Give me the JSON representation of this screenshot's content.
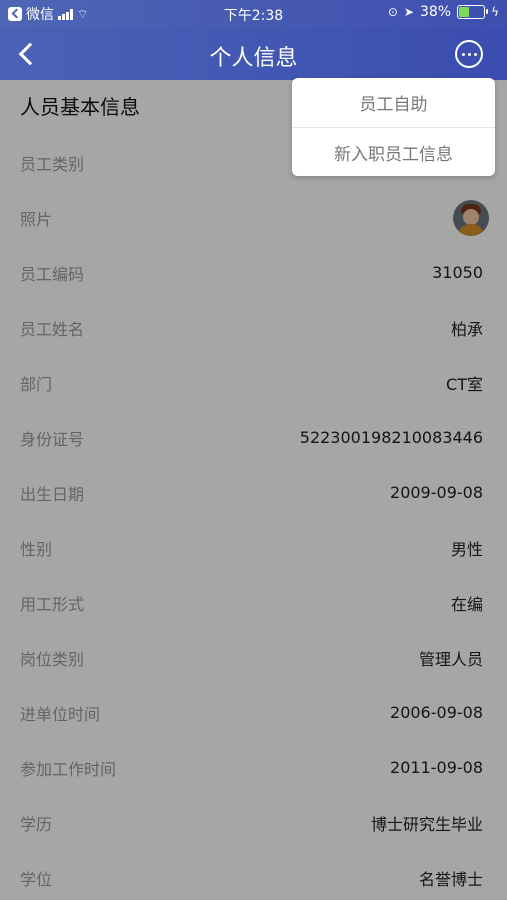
{
  "status_bar": {
    "left_app": "微信",
    "time": "下午2:38",
    "battery": "38%",
    "battery_level": 0.38
  },
  "navbar": {
    "title": "个人信息"
  },
  "menu": {
    "items": [
      "员工自助",
      "新入职员工信息"
    ]
  },
  "section_title": "人员基本信息",
  "fields": [
    {
      "label": "员工类别",
      "value": ""
    },
    {
      "label": "照片",
      "value": ""
    },
    {
      "label": "员工编码",
      "value": "31050"
    },
    {
      "label": "员工姓名",
      "value": "柏承"
    },
    {
      "label": "部门",
      "value": "CT室"
    },
    {
      "label": "身份证号",
      "value": "522300198210083446"
    },
    {
      "label": "出生日期",
      "value": "2009-09-08"
    },
    {
      "label": "性别",
      "value": "男性"
    },
    {
      "label": "用工形式",
      "value": "在编"
    },
    {
      "label": "岗位类别",
      "value": "管理人员"
    },
    {
      "label": "进单位时间",
      "value": "2006-09-08"
    },
    {
      "label": "参加工作时间",
      "value": "2011-09-08"
    },
    {
      "label": "学历",
      "value": "博士研究生毕业"
    },
    {
      "label": "学位",
      "value": "名誉博士"
    }
  ]
}
